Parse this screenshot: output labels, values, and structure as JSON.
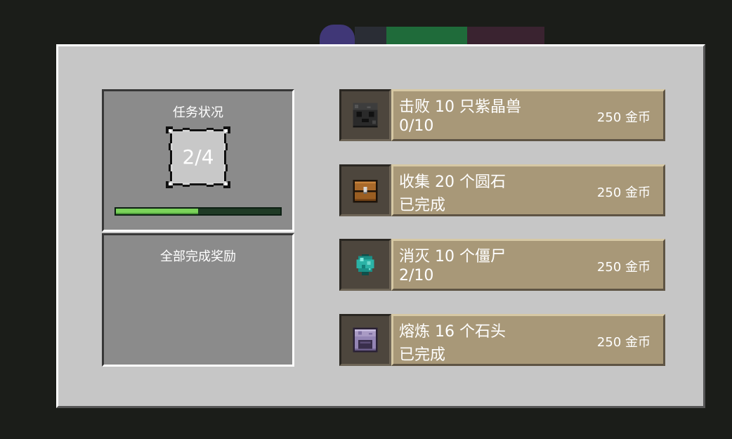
{
  "status_panel": {
    "title": "任务状况",
    "counter": "2/4",
    "progress": 0.5
  },
  "reward_panel": {
    "title": "全部完成奖励"
  },
  "quests": [
    {
      "icon": "wither-skull-block-icon",
      "title": "击败 10 只紫晶兽",
      "status": "0/10",
      "reward": "250 金币"
    },
    {
      "icon": "chest-icon",
      "title": "收集 20 个圆石",
      "status": "已完成",
      "reward": "250 金币"
    },
    {
      "icon": "diamond-ore-icon",
      "title": "消灭 10 个僵尸",
      "status": "2/10",
      "reward": "250 金币"
    },
    {
      "icon": "furnace-icon",
      "title": "熔炼 16 个石头",
      "status": "已完成",
      "reward": "250 金币"
    }
  ],
  "colors": {
    "panel": "#c6c6c6",
    "slot": "#8b8b8b",
    "quest_body": "#a89878",
    "progress_fill": "#7bd35a"
  }
}
